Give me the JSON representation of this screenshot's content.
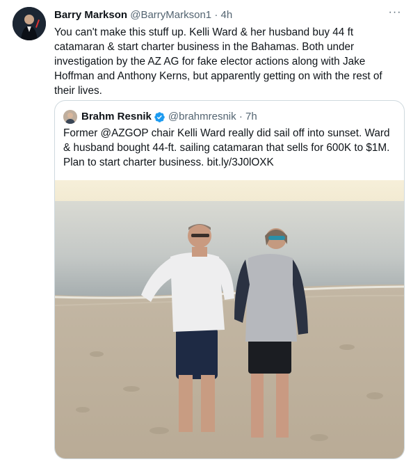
{
  "tweet": {
    "author_name": "Barry Markson",
    "author_handle": "@BarryMarkson1",
    "separator": "·",
    "time": "4h",
    "more_label": "···",
    "text": "You can't make this stuff up. Kelli Ward & her husband buy 44 ft catamaran & start charter business in the Bahamas. Both under investigation by the AZ AG for fake elector actions along with Jake Hoffman and Anthony Kerns, but apparently getting on with the rest of their lives."
  },
  "quote": {
    "author_name": "Brahm Resnik",
    "author_handle": "@brahmresnik",
    "separator": "·",
    "time": "7h",
    "text": "Former @AZGOP chair Kelli Ward really did sail off into sunset.  Ward & husband bought 44-ft. sailing  catamaran that sells for 600K to $1M. Plan to start charter business. bit.ly/3J0lOXK"
  },
  "colors": {
    "text_primary": "#0f1419",
    "text_secondary": "#536471",
    "border": "#cfd9de",
    "verified_blue": "#1d9bf0"
  },
  "icons": {
    "more": "more-horizontal-icon",
    "verified": "verified-badge-icon"
  }
}
